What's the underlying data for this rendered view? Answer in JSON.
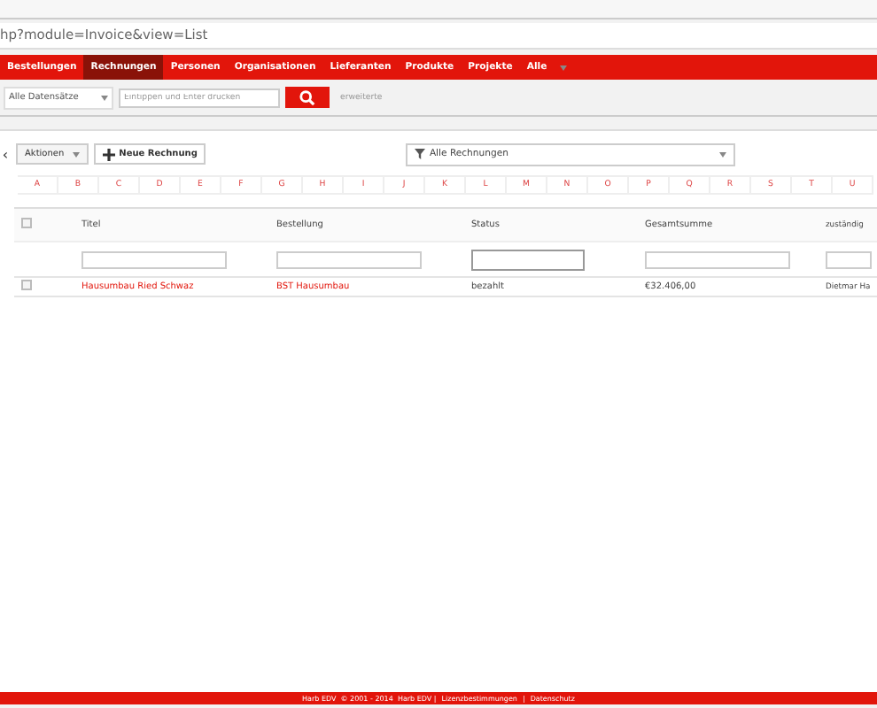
{
  "address_bar": {
    "url": "hp?module=Invoice&view=List"
  },
  "nav": [
    {
      "label": "Bestellungen",
      "selected": false
    },
    {
      "label": "Rechnungen",
      "selected": true
    },
    {
      "label": "Personen",
      "selected": false
    },
    {
      "label": "Organisationen",
      "selected": false
    },
    {
      "label": "Lieferanten",
      "selected": false
    },
    {
      "label": "Produkte",
      "selected": false
    },
    {
      "label": "Projekte",
      "selected": false
    },
    {
      "label": "Alle",
      "selected": false
    }
  ],
  "search": {
    "scope": "Alle Datensätze",
    "placeholder": "Eintippen und Enter drücken",
    "advanced": "erweiterte"
  },
  "toolbar": {
    "back": "‹",
    "actions": "Aktionen",
    "new_button": "Neue Rechnung",
    "filter": "Alle Rechnungen"
  },
  "alphabet": [
    "A",
    "B",
    "C",
    "D",
    "E",
    "F",
    "G",
    "H",
    "I",
    "J",
    "K",
    "L",
    "M",
    "N",
    "O",
    "P",
    "Q",
    "R",
    "S",
    "T",
    "U"
  ],
  "table": {
    "select_all_checked": false,
    "columns": [
      "Titel",
      "Bestellung",
      "Status",
      "Gesamtsumme",
      "zuständig"
    ],
    "rows": [
      {
        "checked": false,
        "cells": [
          "Hausumbau Ried Schwaz",
          "BST Hausumbau",
          "bezahlt",
          "€32.406,00",
          "Dietmar Ha"
        ]
      }
    ]
  },
  "footer": {
    "text": "Harb EDV  © 2001 - 2014  Harb EDV |",
    "links": [
      "Lizenzbestimmungen",
      "Datenschutz"
    ],
    "separator": "|"
  }
}
